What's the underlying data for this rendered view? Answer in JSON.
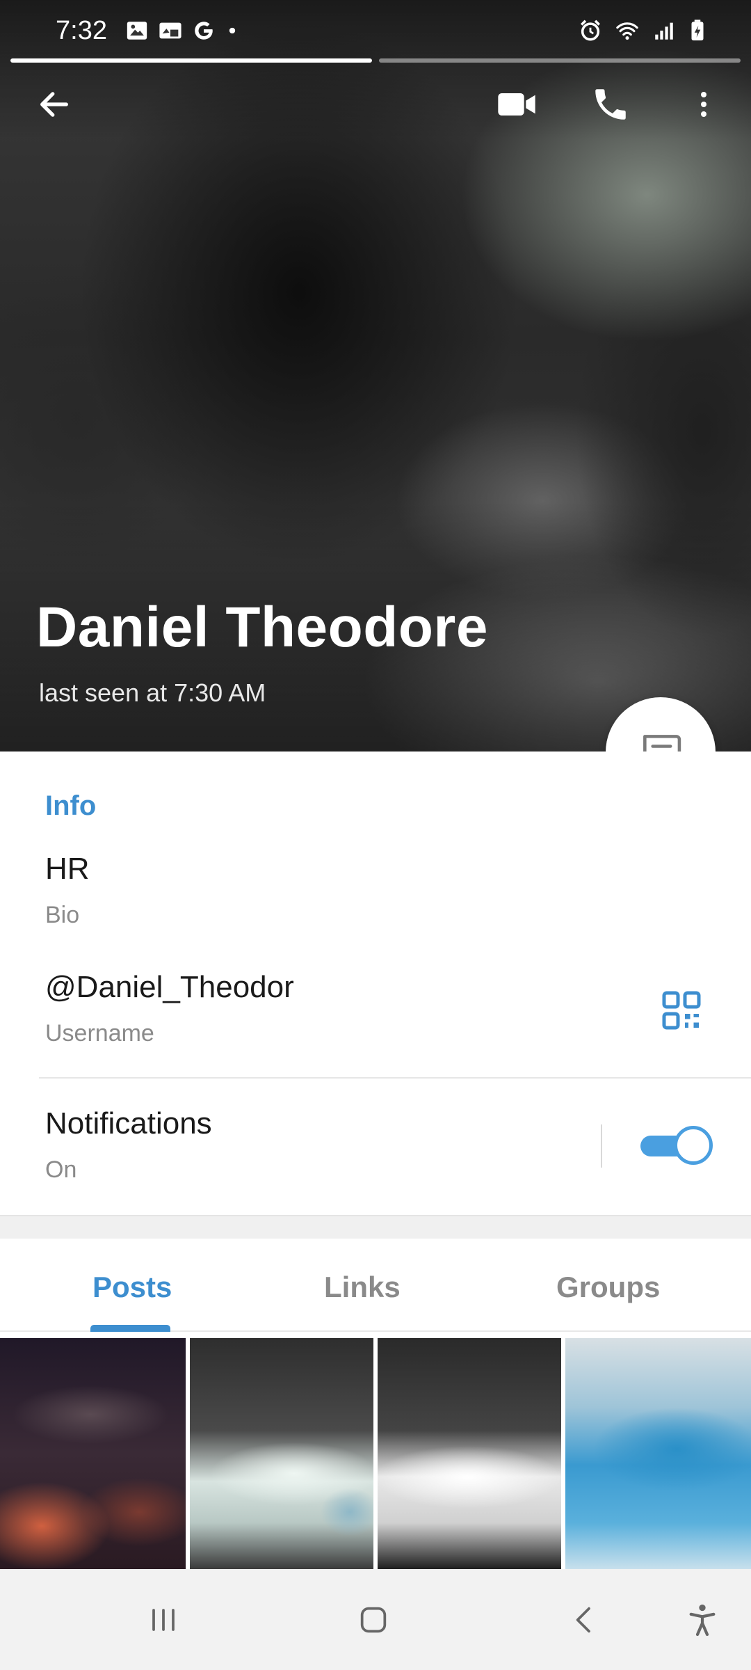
{
  "status_bar": {
    "time": "7:32",
    "left_icons": [
      "gallery-icon",
      "screenshot-icon",
      "google-icon",
      "dot-icon"
    ],
    "right_icons": [
      "alarm-icon",
      "wifi-icon",
      "signal-icon",
      "battery-icon"
    ]
  },
  "story_progress": {
    "segments": 2,
    "active_segment": 1,
    "fill_fraction": 1.0
  },
  "toolbar": {
    "back_icon": "arrow-left-icon",
    "video_icon": "video-call-icon",
    "call_icon": "phone-icon",
    "more_icon": "more-vertical-icon"
  },
  "profile": {
    "name": "Daniel Theodore",
    "last_seen": "last seen at 7:30 AM",
    "message_icon": "message-icon"
  },
  "info": {
    "title": "Info",
    "bio_value": "HR",
    "bio_label": "Bio",
    "username_value": "@Daniel_Theodor",
    "username_label": "Username",
    "notifications_label": "Notifications",
    "notifications_status": "On",
    "notifications_enabled": true
  },
  "tabs": [
    {
      "label": "Posts",
      "active": true
    },
    {
      "label": "Links",
      "active": false
    },
    {
      "label": "Groups",
      "active": false
    }
  ],
  "media": {
    "thumbnail_count": 4
  },
  "colors": {
    "accent": "#3d8ecf",
    "toggle": "#4a9fe0",
    "nav_background": "#f2f2f2"
  },
  "navbar": {
    "icons": [
      "recents-icon",
      "home-icon",
      "back-icon",
      "accessibility-icon"
    ]
  }
}
